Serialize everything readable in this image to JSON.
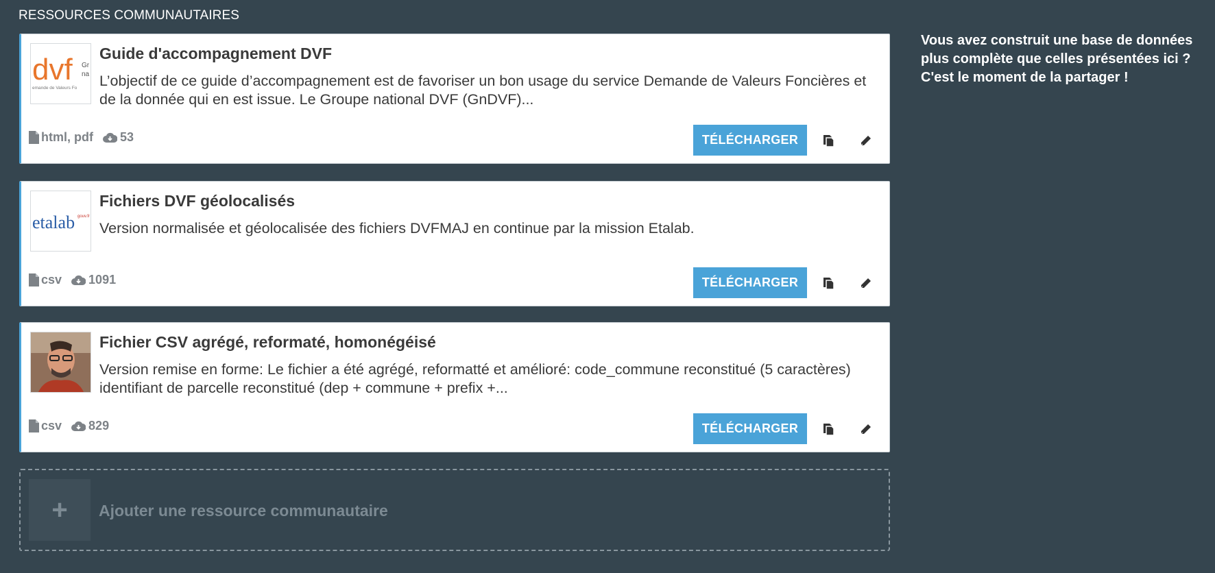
{
  "section": {
    "title": "RESSOURCES COMMUNAUTAIRES"
  },
  "resources": [
    {
      "title": "Guide d'accompagnement DVF",
      "description": "L’objectif de ce guide d’accompagnement est de favoriser un bon usage du service Demande de Valeurs Foncières et de la donnée qui en est issue. Le Groupe national DVF (GnDVF)...",
      "formats": "html, pdf",
      "downloads": "53",
      "logo": {
        "main": "dvf",
        "side1": "Gr",
        "side2": "na",
        "caption": "emande de Valeurs Fo"
      }
    },
    {
      "title": "Fichiers DVF géolocalisés",
      "description": "Version normalisée et géolocalisée des fichiers DVFMAJ en continue par la mission Etalab.",
      "formats": "csv",
      "downloads": "1091",
      "logo": {
        "main": "etalab",
        "sup": "gouv.fr"
      }
    },
    {
      "title": "Fichier CSV agrégé, reformaté, homonégéisé",
      "description": "Version remise en forme: Le fichier a été agrégé, reformatté et amélioré: code_commune reconstitué (5 caractères) identifiant de parcelle reconstitué (dep + commune + prefix +...",
      "formats": "csv",
      "downloads": "829"
    }
  ],
  "buttons": {
    "download_label": "TÉLÉCHARGER"
  },
  "add": {
    "plus": "+",
    "label": "Ajouter une ressource communautaire"
  },
  "side": {
    "text": "Vous avez construit une base de données plus complète que celles présentées ici ? C'est le moment de la partager !"
  },
  "colors": {
    "background": "#35454f",
    "accent": "#4aa3d8",
    "dvf_orange": "#e8762c"
  },
  "icons": [
    "file-icon",
    "cloud-download-icon",
    "copy-icon",
    "pencil-icon",
    "plus-icon"
  ]
}
